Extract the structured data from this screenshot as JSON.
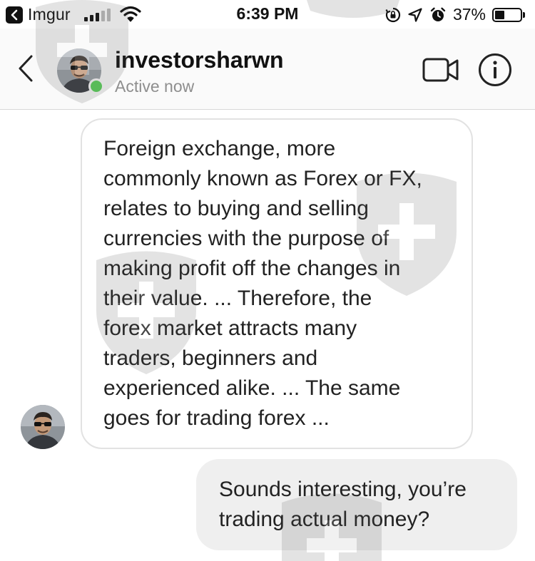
{
  "status_bar": {
    "back_app": "Imgur",
    "time": "6:39 PM",
    "battery_pct": "37%",
    "icons": [
      "back-arrow-icon",
      "cellular-signal-icon",
      "wifi-icon",
      "screen-rotation-lock-icon",
      "location-arrow-icon",
      "alarm-clock-icon",
      "battery-icon"
    ]
  },
  "header": {
    "username": "investorsharwn",
    "status": "Active now",
    "icons": [
      "chevron-left-icon",
      "video-call-icon",
      "info-icon"
    ],
    "online_color": "#5ad05a"
  },
  "messages": [
    {
      "direction": "incoming",
      "lines": [
        "Foreign exchange, more",
        "commonly known as Forex or FX,",
        "relates to buying and selling",
        "currencies with the purpose of",
        "making profit off the changes in",
        "their value. ... Therefore, the",
        "forex market attracts many",
        "traders, beginners and",
        "experienced alike. ... The same",
        "goes for trading forex ..."
      ]
    },
    {
      "direction": "outgoing",
      "lines": [
        "Sounds interesting, you’re",
        "trading actual money?"
      ]
    }
  ],
  "colors": {
    "outgoing_bubble": "#efefef",
    "incoming_border": "#e2e2e2",
    "header_bg": "#fafafa",
    "secondary_text": "#8e8e8e"
  }
}
